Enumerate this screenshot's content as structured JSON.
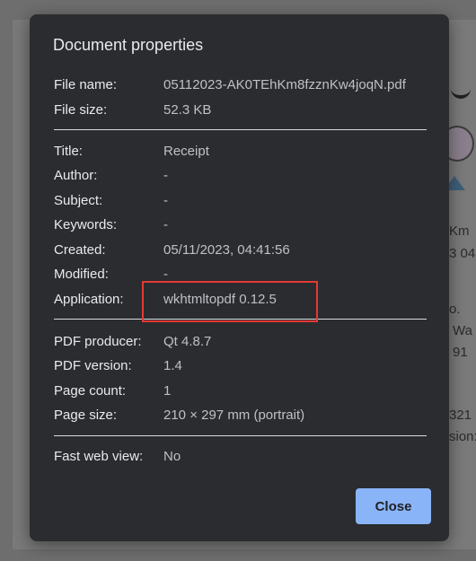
{
  "background": {
    "fragments": [
      "Km",
      "3 04",
      "o.",
      "Wa",
      "91",
      "321",
      "sion:"
    ]
  },
  "dialog": {
    "title": "Document properties",
    "rows": [
      {
        "label": "File name:",
        "value": "05112023-AK0TEhKm8fzznKw4joqN.pdf"
      },
      {
        "label": "File size:",
        "value": "52.3 KB"
      },
      {
        "label": "Title:",
        "value": "Receipt"
      },
      {
        "label": "Author:",
        "value": "-"
      },
      {
        "label": "Subject:",
        "value": "-"
      },
      {
        "label": "Keywords:",
        "value": "-"
      },
      {
        "label": "Created:",
        "value": "05/11/2023, 04:41:56"
      },
      {
        "label": "Modified:",
        "value": "-"
      },
      {
        "label": "Application:",
        "value": "wkhtmltopdf 0.12.5"
      },
      {
        "label": "PDF producer:",
        "value": "Qt 4.8.7"
      },
      {
        "label": "PDF version:",
        "value": "1.4"
      },
      {
        "label": "Page count:",
        "value": "1"
      },
      {
        "label": "Page size:",
        "value": "210 × 297 mm (portrait)"
      },
      {
        "label": "Fast web view:",
        "value": "No"
      }
    ],
    "close_label": "Close",
    "highlight_color": "#e53935",
    "accent_color": "#8ab4f8"
  }
}
